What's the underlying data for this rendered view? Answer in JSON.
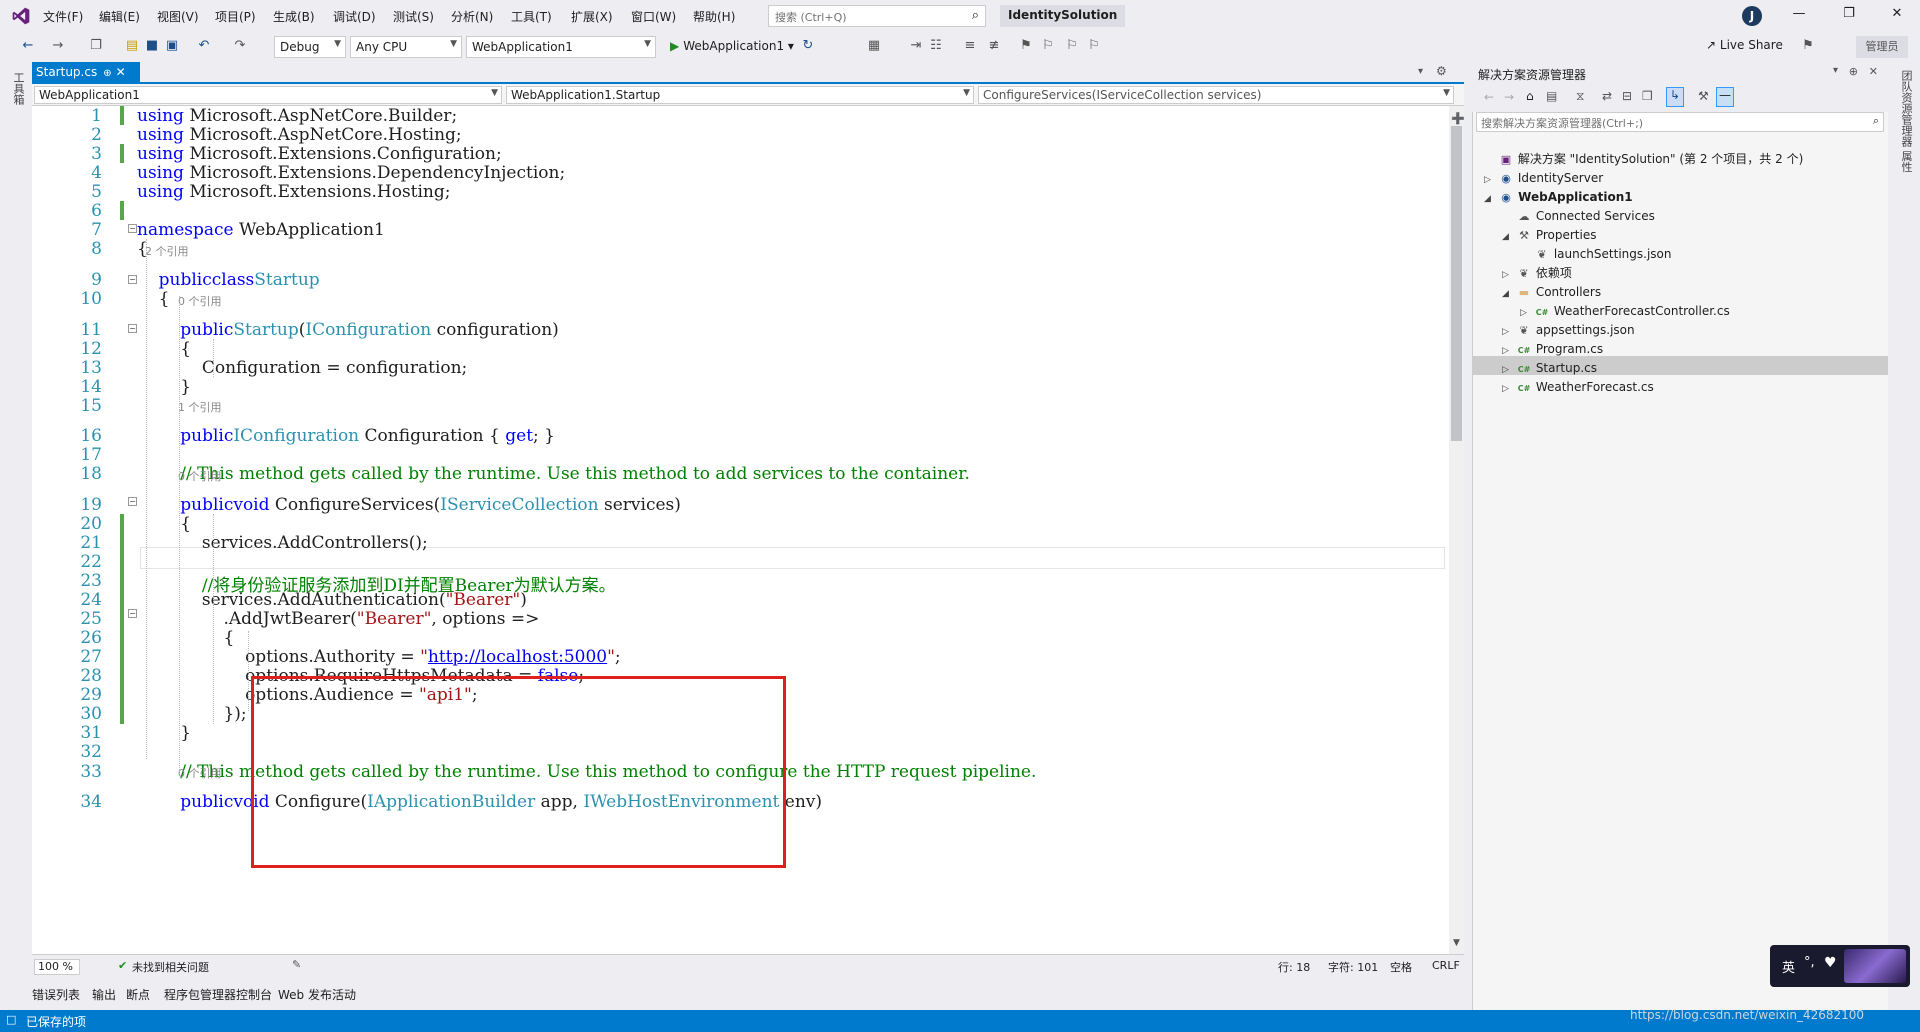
{
  "titlebar": {
    "menus": [
      "文件(F)",
      "编辑(E)",
      "视图(V)",
      "项目(P)",
      "生成(B)",
      "调试(D)",
      "测试(S)",
      "分析(N)",
      "工具(T)",
      "扩展(X)",
      "窗口(W)",
      "帮助(H)"
    ],
    "search_placeholder": "搜索 (Ctrl+Q)",
    "solution_name": "IdentitySolution",
    "avatar_initial": "J"
  },
  "toolbar": {
    "config": "Debug",
    "platform": "Any CPU",
    "startup_project": "WebApplication1",
    "run_label": "WebApplication1",
    "live_share": "Live Share",
    "admin": "管理员"
  },
  "left_strip_label": "工具箱",
  "right_strip_label": "团队资源管理器 属性",
  "editor": {
    "tab_label": "Startup.cs",
    "nav": [
      "WebApplication1",
      "WebApplication1.Startup",
      "ConfigureServices(IServiceCollection services)"
    ],
    "lines": [
      {
        "n": "1",
        "t": [
          [
            "kw",
            "using"
          ],
          [
            "",
            "Microsoft.AspNetCore.Builder;"
          ]
        ]
      },
      {
        "n": "2",
        "t": [
          [
            "kw",
            "using"
          ],
          [
            "",
            "Microsoft.AspNetCore.Hosting;"
          ]
        ]
      },
      {
        "n": "3",
        "t": [
          [
            "kw",
            "using"
          ],
          [
            "",
            "Microsoft.Extensions.Configuration;"
          ]
        ]
      },
      {
        "n": "4",
        "t": [
          [
            "kw",
            "using"
          ],
          [
            "",
            "Microsoft.Extensions.DependencyInjection;"
          ]
        ]
      },
      {
        "n": "5",
        "t": [
          [
            "kw",
            "using"
          ],
          [
            "",
            "Microsoft.Extensions.Hosting;"
          ]
        ]
      },
      {
        "n": "6",
        "t": []
      },
      {
        "n": "7",
        "t": [
          [
            "kw",
            "namespace"
          ],
          [
            "",
            "WebApplication1"
          ]
        ]
      },
      {
        "n": "8",
        "t": [
          [
            "",
            "{"
          ]
        ]
      },
      {
        "n": "9",
        "t": [
          [
            "",
            "    "
          ],
          [
            "kw",
            "public"
          ],
          [
            "",
            ""
          ],
          [
            "kw",
            "class"
          ],
          [
            "",
            ""
          ],
          [
            "ty",
            "Startup"
          ]
        ]
      },
      {
        "n": "10",
        "t": [
          [
            "",
            "    {"
          ]
        ]
      },
      {
        "n": "11",
        "t": [
          [
            "",
            "        "
          ],
          [
            "kw",
            "public"
          ],
          [
            "",
            ""
          ],
          [
            "ty",
            "Startup"
          ],
          [
            "",
            "("
          ],
          [
            "ty",
            "IConfiguration"
          ],
          [
            "",
            "configuration)"
          ]
        ]
      },
      {
        "n": "12",
        "t": [
          [
            "",
            "        {"
          ]
        ]
      },
      {
        "n": "13",
        "t": [
          [
            "",
            "            Configuration = configuration;"
          ]
        ]
      },
      {
        "n": "14",
        "t": [
          [
            "",
            "        }"
          ]
        ]
      },
      {
        "n": "15",
        "t": []
      },
      {
        "n": "16",
        "t": [
          [
            "",
            "        "
          ],
          [
            "kw",
            "public"
          ],
          [
            "",
            ""
          ],
          [
            "ty",
            "IConfiguration"
          ],
          [
            "",
            "Configuration { "
          ],
          [
            "kw",
            "get"
          ],
          [
            "",
            "; }"
          ]
        ]
      },
      {
        "n": "17",
        "t": []
      },
      {
        "n": "18",
        "t": [
          [
            "",
            "        "
          ],
          [
            "cm",
            "// This method gets called by the runtime. Use this method to add services to the container."
          ]
        ]
      },
      {
        "n": "19",
        "t": [
          [
            "",
            "        "
          ],
          [
            "kw",
            "public"
          ],
          [
            "",
            ""
          ],
          [
            "kw",
            "void"
          ],
          [
            "",
            "ConfigureServices("
          ],
          [
            "ty",
            "IServiceCollection"
          ],
          [
            "",
            "services)"
          ]
        ]
      },
      {
        "n": "20",
        "t": [
          [
            "",
            "        {"
          ]
        ]
      },
      {
        "n": "21",
        "t": [
          [
            "",
            "            services.AddControllers();"
          ]
        ]
      },
      {
        "n": "22",
        "t": []
      },
      {
        "n": "23",
        "t": [
          [
            "",
            "            "
          ],
          [
            "cm",
            "//将身份验证服务添加到DI并配置Bearer为默认方案。"
          ]
        ]
      },
      {
        "n": "24",
        "t": [
          [
            "",
            "            services.AddAuthentication("
          ],
          [
            "st",
            "\"Bearer\""
          ],
          [
            "",
            ")"
          ]
        ]
      },
      {
        "n": "25",
        "t": [
          [
            "",
            "                .AddJwtBearer("
          ],
          [
            "st",
            "\"Bearer\""
          ],
          [
            "",
            ", options =>"
          ]
        ]
      },
      {
        "n": "26",
        "t": [
          [
            "",
            "                {"
          ]
        ]
      },
      {
        "n": "27",
        "t": [
          [
            "",
            "                    options.Authority = "
          ],
          [
            "st",
            "\""
          ],
          [
            "lk",
            "http://localhost:5000"
          ],
          [
            "st",
            "\""
          ],
          [
            "",
            ";"
          ]
        ]
      },
      {
        "n": "28",
        "t": [
          [
            "",
            "                    options.RequireHttpsMetadata = "
          ],
          [
            "kw",
            "false"
          ],
          [
            "",
            ";"
          ]
        ]
      },
      {
        "n": "29",
        "t": [
          [
            "",
            "                    options.Audience = "
          ],
          [
            "st",
            "\"api1\""
          ],
          [
            "",
            ";"
          ]
        ]
      },
      {
        "n": "30",
        "t": [
          [
            "",
            "                });"
          ]
        ]
      },
      {
        "n": "31",
        "t": [
          [
            "",
            "        }"
          ]
        ]
      },
      {
        "n": "32",
        "t": []
      },
      {
        "n": "33",
        "t": [
          [
            "",
            "        "
          ],
          [
            "cm",
            "// This method gets called by the runtime. Use this method to configure the HTTP request pipeline."
          ]
        ]
      },
      {
        "n": "34",
        "t": [
          [
            "",
            "        "
          ],
          [
            "kw",
            "public"
          ],
          [
            "",
            ""
          ],
          [
            "kw",
            "void"
          ],
          [
            "",
            "Configure("
          ],
          [
            "ty",
            "IApplicationBuilder"
          ],
          [
            "",
            "app, "
          ],
          [
            "ty",
            "IWebHostEnvironment"
          ],
          [
            "",
            "env)"
          ]
        ]
      }
    ],
    "lens": {
      "l9": "2 个引用",
      "l11": "0 个引用",
      "l16": "1 个引用",
      "l19": "0 个引用",
      "l34": "0 个引用"
    }
  },
  "editor_status": {
    "zoom": "100 %",
    "issues": "未找到相关问题",
    "line": "行: 18",
    "col": "字符: 101",
    "ws": "空格",
    "eol": "CRLF"
  },
  "bottom_tabs": [
    "错误列表",
    "输出",
    "断点",
    "程序包管理器控制台",
    "Web 发布活动"
  ],
  "status": {
    "text": "已保存的项"
  },
  "solution_explorer": {
    "title": "解决方案资源管理器",
    "search_placeholder": "搜索解决方案资源管理器(Ctrl+;)",
    "items": [
      {
        "label": "解决方案 \"IdentitySolution\" (第 2 个项目，共 2 个)",
        "bold": false
      },
      {
        "label": "IdentityServer",
        "bold": false
      },
      {
        "label": "WebApplication1",
        "bold": true
      },
      {
        "label": "Connected Services",
        "bold": false
      },
      {
        "label": "Properties",
        "bold": false
      },
      {
        "label": "launchSettings.json",
        "bold": false
      },
      {
        "label": "依赖项",
        "bold": false
      },
      {
        "label": "Controllers",
        "bold": false
      },
      {
        "label": "WeatherForecastController.cs",
        "bold": false
      },
      {
        "label": "appsettings.json",
        "bold": false
      },
      {
        "label": "Program.cs",
        "bold": false
      },
      {
        "label": "Startup.cs",
        "bold": false
      },
      {
        "label": "WeatherForecast.cs",
        "bold": false
      }
    ]
  },
  "ime": {
    "label": "英"
  },
  "watermark": "https://blog.csdn.net/weixin_42682100",
  "colors": {
    "accent": "#007acc",
    "highlight_box": "#e02020",
    "keyword": "#0000ff",
    "type": "#2b91af",
    "comment": "#008000",
    "string": "#a31515"
  }
}
